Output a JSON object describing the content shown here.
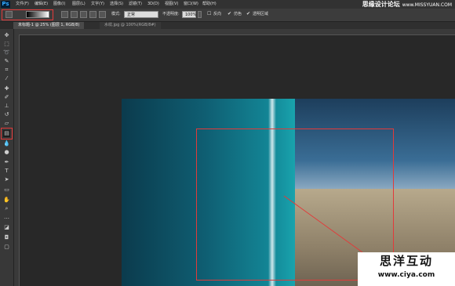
{
  "app": {
    "logo": "Ps"
  },
  "menu": [
    "文件(F)",
    "编辑(E)",
    "图像(I)",
    "图层(L)",
    "文字(Y)",
    "选择(S)",
    "滤镜(T)",
    "3D(D)",
    "视图(V)",
    "窗口(W)",
    "帮助(H)"
  ],
  "watermark_top": {
    "text": "思缘设计论坛",
    "url": "www.MISSYUAN.COM"
  },
  "options": {
    "mode_label": "模式:",
    "mode_value": "正常",
    "opacity_label": "不透明度:",
    "opacity_value": "100%",
    "reverse_label": "反向",
    "dither_label": "仿色",
    "transparency_label": "透明区域"
  },
  "tabs": [
    {
      "label": "未标题-1 @ 25% (图层 1, RGB/8)",
      "active": true
    },
    {
      "label": "水纹.jpg @ 100%(RGB/8#)",
      "active": false
    }
  ],
  "tools": [
    "move",
    "marquee",
    "lasso",
    "quick-select",
    "crop",
    "eyedropper",
    "healing",
    "brush",
    "clone-stamp",
    "history-brush",
    "eraser",
    "gradient",
    "blur",
    "dodge",
    "pen",
    "type",
    "path-select",
    "shape",
    "hand",
    "zoom",
    "more",
    "colors",
    "quick-mask",
    "screen-mode"
  ],
  "watermark_box": {
    "cn": "思洋互动",
    "url": "www.ciya.com"
  },
  "colors": {
    "selection": "#e23a3a",
    "sea": "#138797",
    "sky": "#3a6d95",
    "sand": "#b7a98c"
  }
}
